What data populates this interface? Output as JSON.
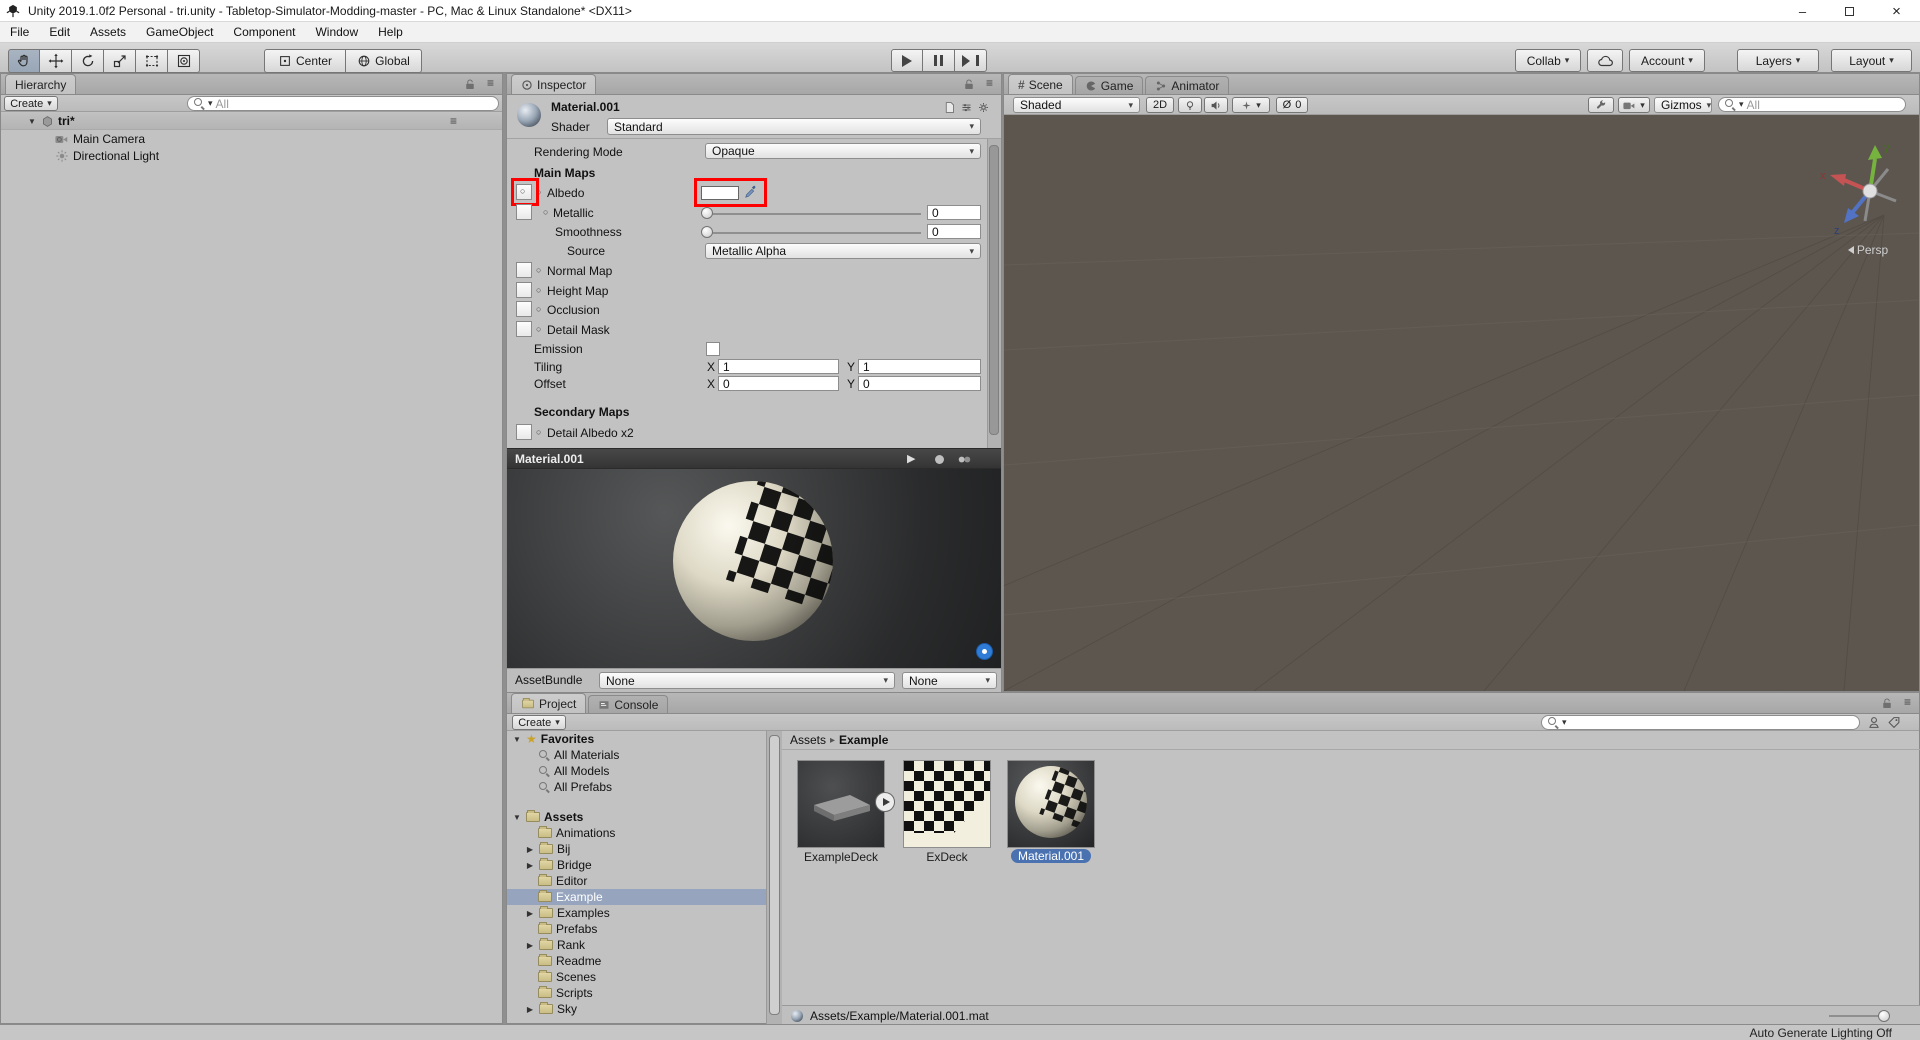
{
  "colors": {
    "highlight_red": "#ff0000",
    "selection_blue": "#4a72b0",
    "tree_selection": "#96a5bd",
    "scene_bg": "#5d564f"
  },
  "title_bar": {
    "title": "Unity 2019.1.0f2 Personal - tri.unity - Tabletop-Simulator-Modding-master - PC, Mac & Linux Standalone* <DX11>"
  },
  "menu_bar": {
    "items": [
      "File",
      "Edit",
      "Assets",
      "GameObject",
      "Component",
      "Window",
      "Help"
    ]
  },
  "toolbar": {
    "pivot": "Center",
    "space": "Global",
    "collab": "Collab",
    "account": "Account",
    "layers": "Layers",
    "layout": "Layout"
  },
  "hierarchy": {
    "tab": "Hierarchy",
    "create": "Create",
    "search_placeholder": "All",
    "scene_name": "tri*",
    "items": [
      {
        "label": "Main Camera"
      },
      {
        "label": "Directional Light"
      }
    ]
  },
  "inspector": {
    "tab": "Inspector",
    "name": "Material.001",
    "shader_label": "Shader",
    "shader": "Standard",
    "rendering_mode_label": "Rendering Mode",
    "rendering_mode": "Opaque",
    "main_maps": "Main Maps",
    "albedo": "Albedo",
    "metallic": "Metallic",
    "metallic_value": "0",
    "smoothness": "Smoothness",
    "smoothness_value": "0",
    "source_label": "Source",
    "source": "Metallic Alpha",
    "normal_map": "Normal Map",
    "height_map": "Height Map",
    "occlusion": "Occlusion",
    "detail_mask": "Detail Mask",
    "emission": "Emission",
    "tiling": "Tiling",
    "offset": "Offset",
    "x_label": "X",
    "y_label": "Y",
    "tiling_x": "1",
    "tiling_y": "1",
    "offset_x": "0",
    "offset_y": "0",
    "secondary_maps": "Secondary Maps",
    "detail_albedo": "Detail Albedo x2"
  },
  "preview": {
    "title": "Material.001",
    "assetbundle_label": "AssetBundle",
    "bundle": "None",
    "variant": "None"
  },
  "scene_view": {
    "tabs": [
      {
        "label": "Scene"
      },
      {
        "label": "Game"
      },
      {
        "label": "Animator"
      }
    ],
    "shaded": "Shaded",
    "mode_2d": "2D",
    "effects_count": "0",
    "gizmos": "Gizmos",
    "search_placeholder": "All",
    "persp": "Persp"
  },
  "project": {
    "tab": "Project",
    "console_tab": "Console",
    "create": "Create",
    "favorites_label": "Favorites",
    "favorites": [
      {
        "label": "All Materials"
      },
      {
        "label": "All Models"
      },
      {
        "label": "All Prefabs"
      }
    ],
    "assets_label": "Assets",
    "folders": [
      {
        "label": "Animations"
      },
      {
        "label": "Bij"
      },
      {
        "label": "Bridge"
      },
      {
        "label": "Editor"
      },
      {
        "label": "Example"
      },
      {
        "label": "Examples"
      },
      {
        "label": "Prefabs"
      },
      {
        "label": "Rank"
      },
      {
        "label": "Readme"
      },
      {
        "label": "Scenes"
      },
      {
        "label": "Scripts"
      },
      {
        "label": "Sky"
      }
    ],
    "selected_folder": "Example",
    "breadcrumb_root": "Assets",
    "breadcrumb_current": "Example",
    "files": [
      {
        "name": "ExampleDeck"
      },
      {
        "name": "ExDeck"
      },
      {
        "name": "Material.001"
      }
    ],
    "selected_file": "Material.001",
    "selected_path": "Assets/Example/Material.001.mat"
  },
  "status_bar": {
    "lighting": "Auto Generate Lighting Off"
  },
  "icons": {
    "caret": "▾",
    "foldout_open": "▼",
    "foldout_closed": "▶",
    "menu": "≡",
    "close": "×",
    "minimize": "–",
    "star": "★",
    "picker_circle": "○",
    "scene_hash": "#",
    "breadcrumb_sep": "▸",
    "zero_slash": "Ø",
    "play": "▶"
  }
}
